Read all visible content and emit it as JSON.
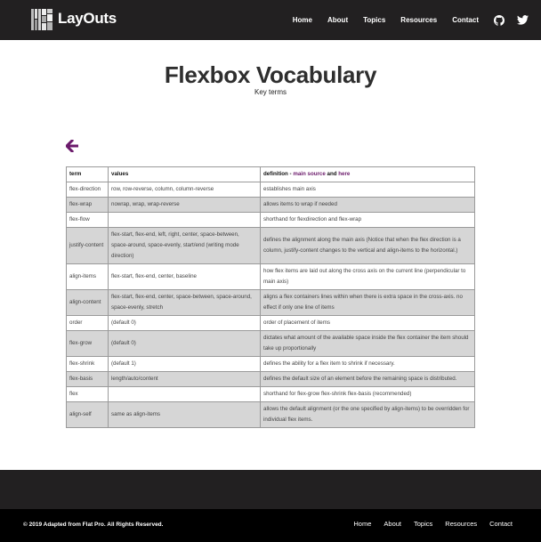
{
  "header": {
    "brand": "LayOuts",
    "nav": [
      "Home",
      "About",
      "Topics",
      "Resources",
      "Contact"
    ]
  },
  "page": {
    "title": "Flexbox Vocabulary",
    "subtitle": "Key terms"
  },
  "table": {
    "headers": {
      "term": "term",
      "values": "values",
      "definition_prefix": "definition - ",
      "main_source": "main source",
      "and": " and ",
      "here": "here"
    },
    "rows": [
      {
        "term": "flex-direction",
        "values": "row, row-reverse, column, column-reverse",
        "definition": "establishes main axis"
      },
      {
        "term": "flex-wrap",
        "values": "nowrap, wrap, wrap-reverse",
        "definition": "allows items to wrap if needed"
      },
      {
        "term": "flex-flow",
        "values": "",
        "definition": "shorthand for flexdirection and flex-wrap"
      },
      {
        "term": "justify-content",
        "values": "flex-start, flex-end, left, right, center, space-between, space-around, space-evenly, start/end (writing mode direction)",
        "definition": "defines the alignment along the main axis (Notice that when the flex direction is a column, justify-content changes to the vertical and align-items to the horizontal.)"
      },
      {
        "term": "align-items",
        "values": "flex-start, flex-end, center, baseline",
        "definition": "how flex items are laid out along the cross axis on the current line (perpendicular to main axis)"
      },
      {
        "term": "align-content",
        "values": "flex-start, flex-end, center, space-between, space-around, space-evenly, stretch",
        "definition": "aligns a flex containers lines within when there is extra space in the cross-axis. no effect if only one line of items"
      },
      {
        "term": "order",
        "values": "(default 0)",
        "definition": "order of placement of items"
      },
      {
        "term": "flex-grow",
        "values": "(default 0)",
        "definition": "dictates what amount of the available space inside the flex container the item should take up proportionally"
      },
      {
        "term": "flex-shrink",
        "values": "(default 1)",
        "definition": "defines the ability for a flex item to shrink if necessary."
      },
      {
        "term": "flex-basis",
        "values": "length/auto/content",
        "definition": "defines the default size of an element before the remaining space is distributed."
      },
      {
        "term": "flex",
        "values": "",
        "definition": "shorthand for flex-grow flex-shrink flex-basis (recommended)"
      },
      {
        "term": "align-self",
        "values": "same as align-items",
        "definition": "allows the default alignment (or the one specified by align-items) to be overridden for individual flex items."
      }
    ]
  },
  "footer": {
    "copyright": "© 2019 Adapted from Flat Pro. All Rights Reserved.",
    "nav": [
      "Home",
      "About",
      "Topics",
      "Resources",
      "Contact"
    ]
  },
  "colors": {
    "nav_bg": "#222021",
    "footer_bg": "#000000",
    "accent": "#6b1a6b",
    "row_alt": "#d6d6d6"
  },
  "icons": {
    "logo": "layout-grid-logo",
    "github": "github-icon",
    "twitter": "twitter-icon",
    "back": "back-arrow-icon"
  }
}
